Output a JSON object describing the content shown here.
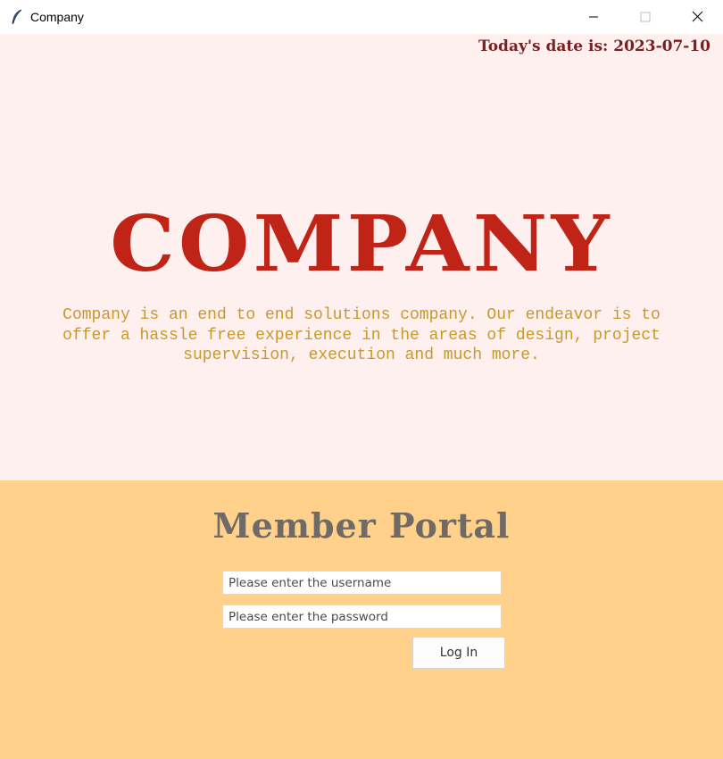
{
  "window": {
    "title": "Company",
    "icon": "feather-icon",
    "controls": [
      "minimize-icon",
      "maximize-icon",
      "close-icon"
    ]
  },
  "header": {
    "date_prefix": "Today's date is: ",
    "date_value": "2023-07-10"
  },
  "hero": {
    "title": "COMPANY",
    "description": "Company is an end to end solutions company. Our endeavor is to offer a hassle free experience in the areas of design, project supervision, execution and much more."
  },
  "portal": {
    "title": "Member Portal",
    "username_placeholder": "Please enter the username",
    "password_placeholder": "Please enter the password",
    "login_label": "Log In"
  },
  "colors": {
    "top_background": "#fff0f0",
    "bottom_background": "#ffd18a",
    "title_red": "#bf2417",
    "description_gold": "#c8982a",
    "date_maroon": "#7b2020",
    "portal_gray": "#6f6a66"
  }
}
